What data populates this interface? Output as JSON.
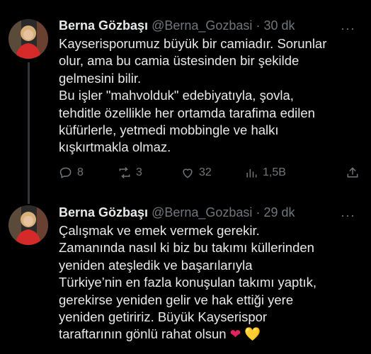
{
  "tweets": [
    {
      "author_name": "Berna Gözbaşı",
      "handle": "@Berna_Gozbasi",
      "separator": "·",
      "time": "30 dk",
      "text": "Kayserisporumuz büyük bir camiadır.  Sorunlar\nolur, ama bu camia üstesinden bir şekilde\ngelmesini bilir.\nBu işler \"mahvolduk\" edebiyatıyla, şovla,\ntehditle özellikle her ortamda tarafima edilen\nküfürlerle, yetmedi mobbingle ve halkı\nkışkırtmakla olmaz.",
      "replies": "8",
      "retweets": "3",
      "likes": "32",
      "views": "1,5B"
    },
    {
      "author_name": "Berna Gözbaşı",
      "handle": "@Berna_Gozbasi",
      "separator": "·",
      "time": "29 dk",
      "text": "Çalışmak ve emek vermek gerekir.\nZamanında nasıl ki biz bu takımı küllerinden\nyeniden ateşledik ve başarılarıyla\nTürkiye’nin en fazla  konuşulan takımı yaptık,\ngerekirse yeniden gelir ve hak ettiği yere\nyeniden getiririz. Büyük Kayserispor\ntaraftarının gönlü rahat olsun",
      "emoji_red": "❤",
      "emoji_yellow": "💛"
    }
  ],
  "more_label": "···",
  "colors": {
    "background": "#000000",
    "text": "#e7e9ea",
    "muted": "#71767b",
    "thread_line": "#333639"
  }
}
